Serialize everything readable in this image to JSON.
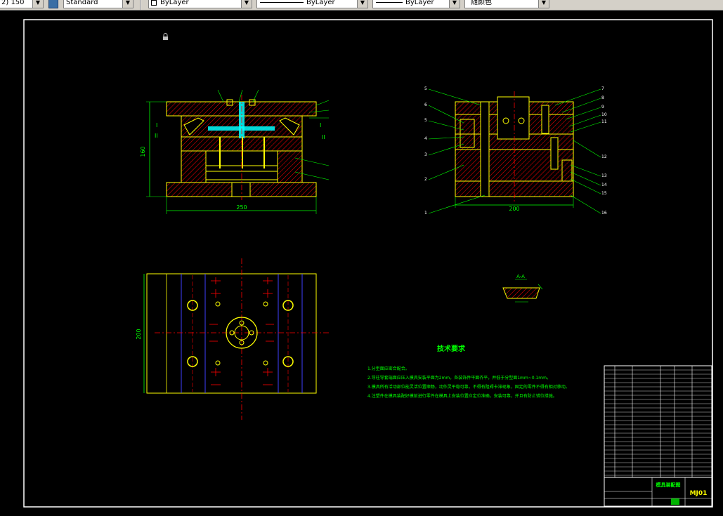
{
  "toolbar": {
    "scale_value": "2) 150",
    "text_style": "Standard",
    "layer": "ByLayer",
    "linetype": "ByLayer",
    "lineweight": "ByLayer",
    "color": "随颜色"
  },
  "drawing": {
    "front_view": {
      "dim_height": "160",
      "dim_width": "250",
      "section_marks": [
        "I",
        "II",
        "I",
        "II"
      ]
    },
    "side_view": {
      "dim_width": "200",
      "balloons": [
        "5",
        "6",
        "5",
        "4",
        "3",
        "2",
        "1",
        "7",
        "8",
        "9",
        "10",
        "11",
        "12",
        "13",
        "14",
        "15",
        "16"
      ]
    },
    "plan_view": {
      "dim_height": "200"
    },
    "section_label": "A-A",
    "tech_req": {
      "title": "技术要求",
      "items": [
        "1.分型面应密合配合。",
        "2.导柱导套端面应压入模具安装平面为2mm，各装饰件平面齐平，并低于分型面1mm~0.1mm。",
        "3.模具所有活动部位能灵活位置顺畅，动作灵平稳可靠，不得有阻碍卡滞现象，固定的零件不得有相对移动。",
        "4.注塑件在模具装配好模前进行零件在模具上安装位置应定位准确，安装可靠，并且有防止错位措施。"
      ]
    },
    "title_block": {
      "drawing_name": "模具装配图",
      "drawing_number": "MJ01"
    }
  },
  "colors": {
    "background": "#000000",
    "outline": "#ffff00",
    "dimension": "#00ff00",
    "hatch": "#ff0000",
    "centerline": "#ff0000",
    "core": "#00ffff",
    "guide": "#4040ff",
    "white": "#ffffff"
  }
}
